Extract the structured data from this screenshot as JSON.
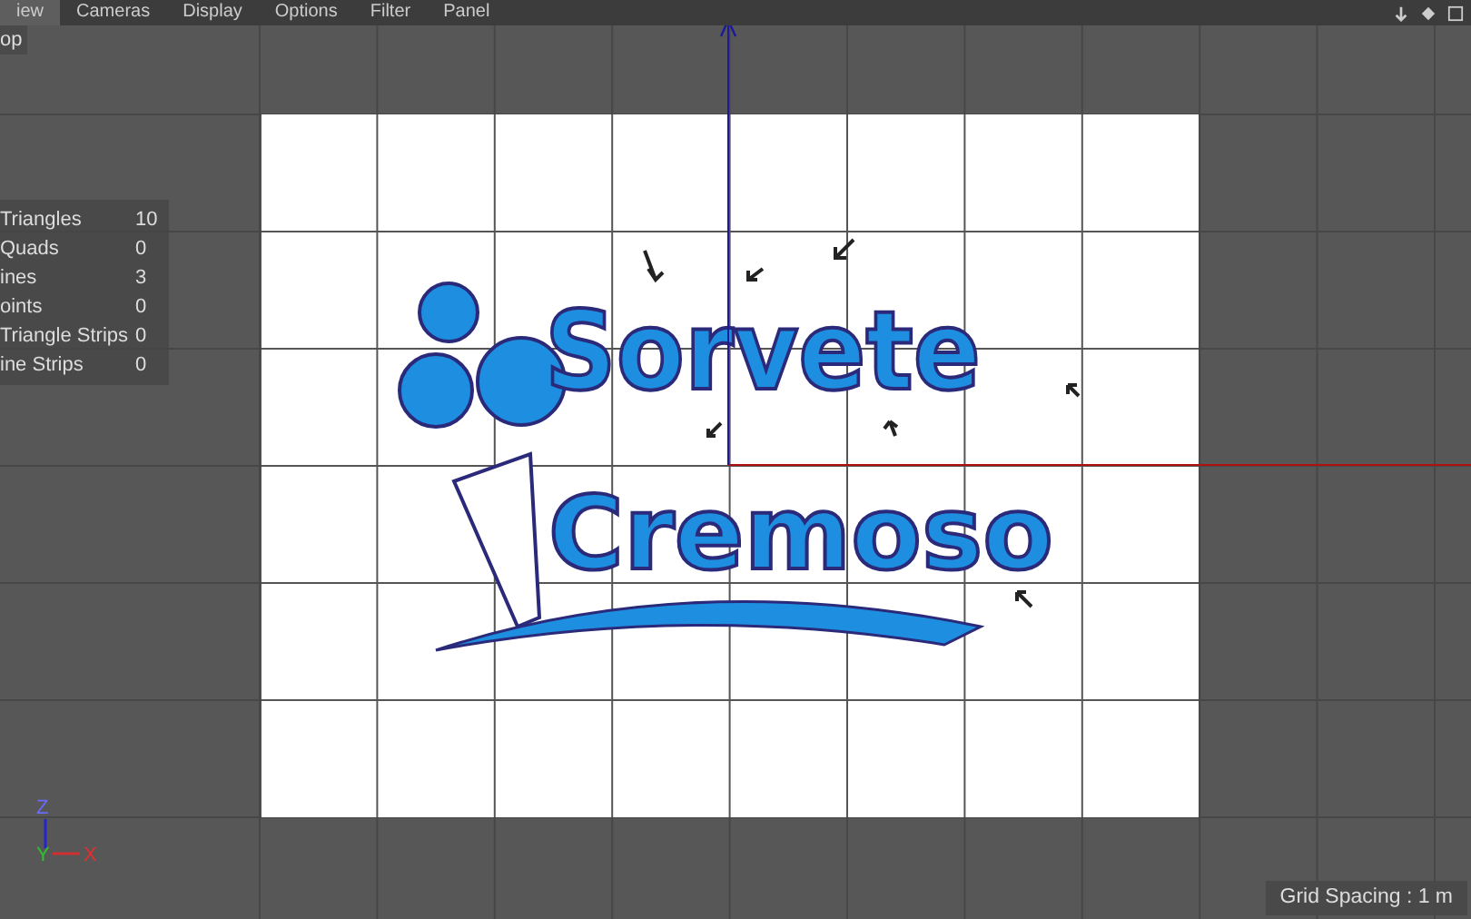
{
  "menu": [
    {
      "label": "iew",
      "selected": true
    },
    {
      "label": "Cameras",
      "selected": false
    },
    {
      "label": "Display",
      "selected": false
    },
    {
      "label": "Options",
      "selected": false
    },
    {
      "label": "Filter",
      "selected": false
    },
    {
      "label": "Panel",
      "selected": false
    }
  ],
  "viewport": {
    "view_label": "op",
    "stats": [
      {
        "name": "Triangles",
        "value": "10"
      },
      {
        "name": "Quads",
        "value": "0"
      },
      {
        "name": "ines",
        "value": "3"
      },
      {
        "name": "oints",
        "value": "0"
      },
      {
        "name": "Triangle Strips",
        "value": "0"
      },
      {
        "name": "ine Strips",
        "value": "0"
      }
    ],
    "image": {
      "lines": [
        "Sorvete",
        "Cremoso"
      ]
    },
    "axes": [
      "Z",
      "Y",
      "X"
    ],
    "grid_spacing": "Grid Spacing : 1 m"
  }
}
